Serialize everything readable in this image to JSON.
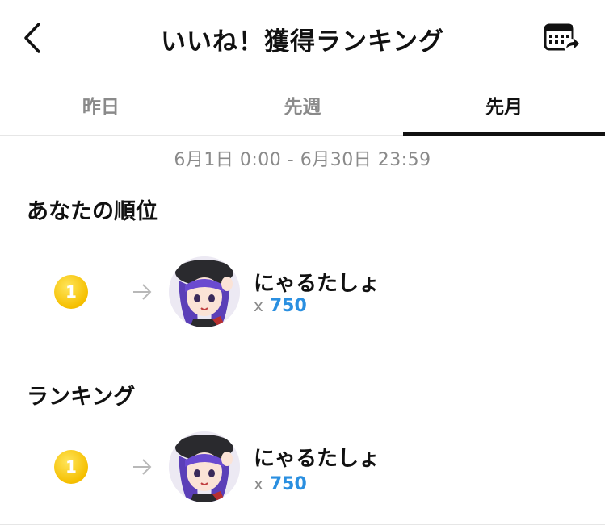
{
  "header": {
    "title": "いいね！獲得ランキング"
  },
  "tabs": [
    {
      "label": "昨日",
      "active": false
    },
    {
      "label": "先週",
      "active": false
    },
    {
      "label": "先月",
      "active": true
    }
  ],
  "date_range": "6月1日 0:00 - 6月30日 23:59",
  "my_rank": {
    "section_title": "あなたの順位",
    "rank": "1",
    "username": "にゃるたしょ",
    "like_prefix": "x",
    "likes": "750"
  },
  "ranking": {
    "section_title": "ランキング",
    "entries": [
      {
        "rank": "1",
        "username": "にゃるたしょ",
        "like_prefix": "x",
        "likes": "750"
      }
    ]
  },
  "colors": {
    "accent_blue": "#2a8fe0",
    "medal_gold": "#f5bf00",
    "muted_text": "#8a8a8a"
  },
  "icons": {
    "back": "chevron-left-icon",
    "calendar": "calendar-share-icon",
    "arrow": "arrow-right-icon"
  }
}
